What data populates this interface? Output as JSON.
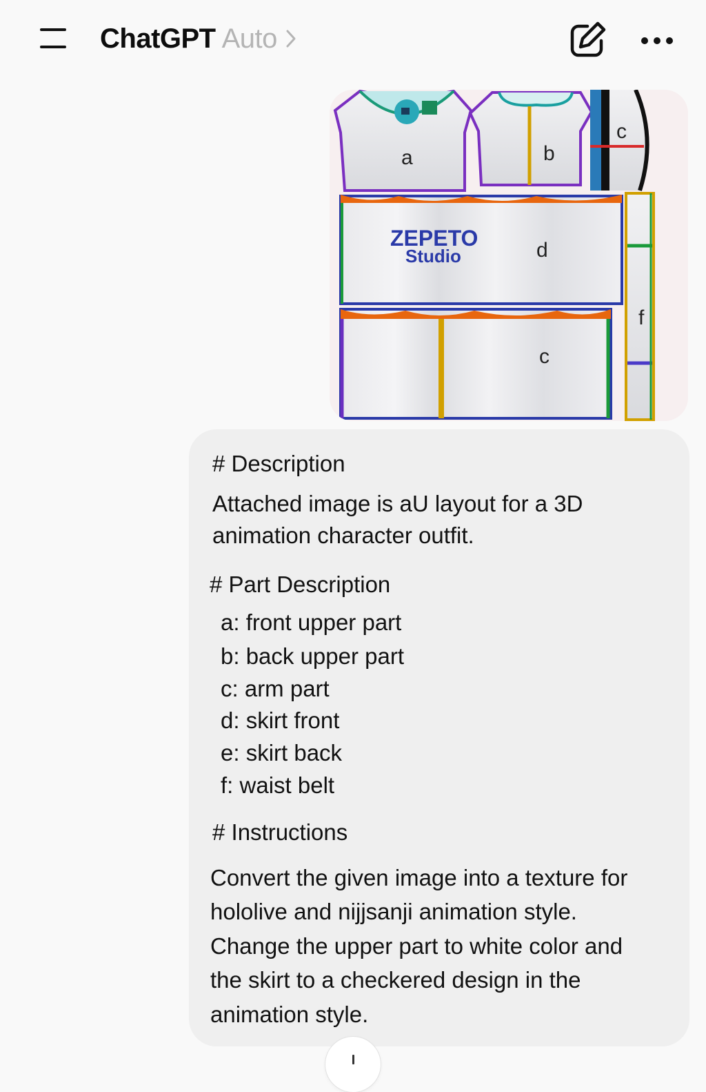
{
  "header": {
    "app_name": "ChatGPT",
    "model_label": "Auto",
    "menu_icon": "menu-icon",
    "edit_icon": "new-chat-icon",
    "more_icon": "more-icon"
  },
  "attachment": {
    "panel_labels": {
      "a": "a",
      "b": "b",
      "c_top": "c",
      "d": "d",
      "c_bottom": "c",
      "f": "f"
    },
    "logo_line1": "ZEPETO",
    "logo_line2": "Studio"
  },
  "message": {
    "heading_description": "# Description",
    "description_line1": "Attached image is aU layout for a 3D",
    "description_line2": "animation character outfit.",
    "heading_parts": "# Part Description",
    "parts": [
      "a: front upper part",
      "b: back upper part",
      "c: arm part",
      "d: skirt front",
      "e: skirt back",
      "f: waist belt"
    ],
    "heading_instructions": "# Instructions",
    "instructions_lines": [
      "Convert the given image into a texture for",
      "hololive and nijjsanji animation style.",
      "Change the upper part to white color and",
      "the skirt to a checkered design in the",
      "animation style."
    ]
  },
  "colors": {
    "background": "#f9f9f9",
    "bubble": "#efefef",
    "muted_text": "#b4b4b4",
    "logo_blue": "#2a3aa8"
  }
}
